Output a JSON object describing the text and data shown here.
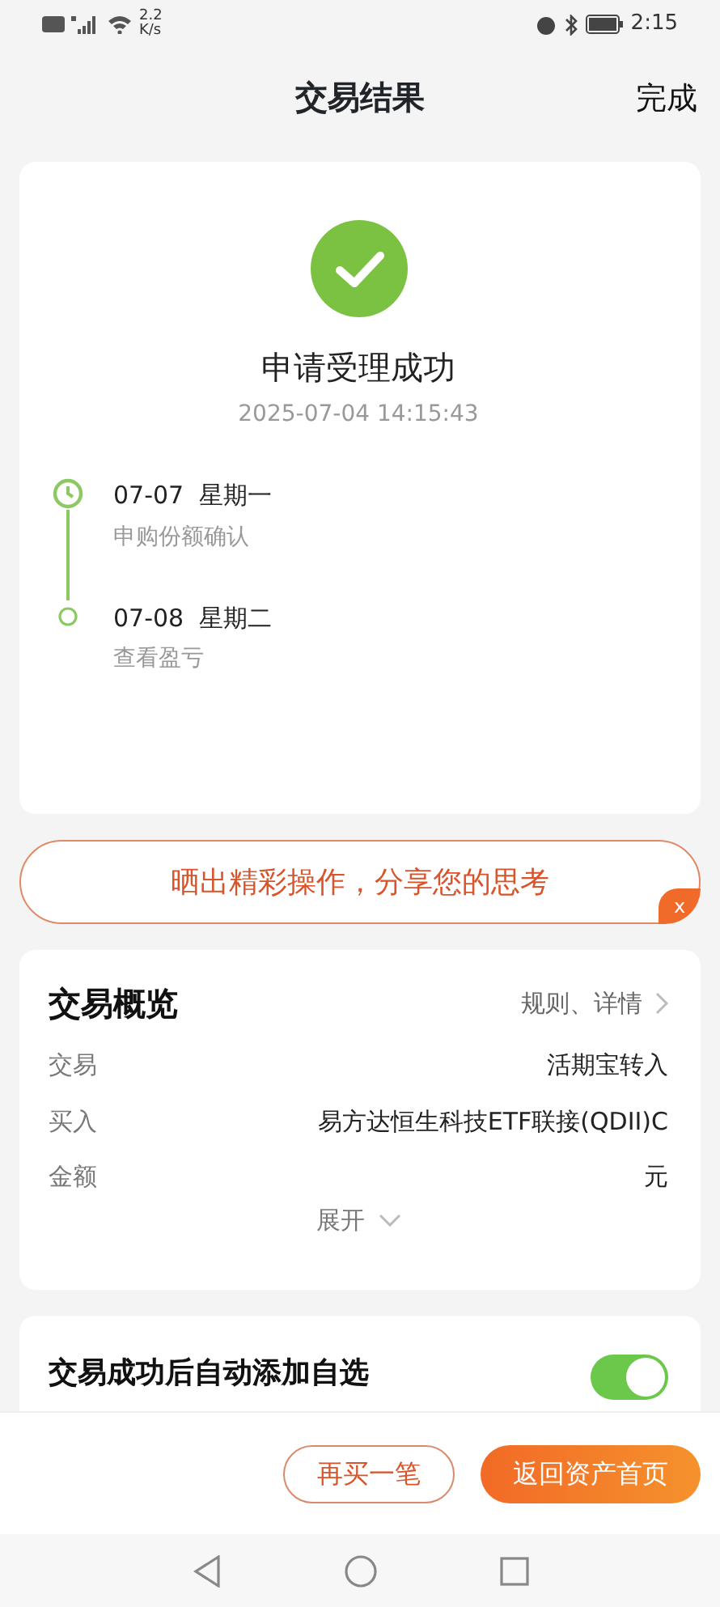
{
  "status_bar": {
    "speed": [
      "2.2",
      "K/s"
    ],
    "time": "2:15"
  },
  "header": {
    "title": "交易结果",
    "action": "完成"
  },
  "result": {
    "title": "申请受理成功",
    "time": "2025-07-04 14:15:43",
    "timeline": [
      {
        "date": "07-07  星期一",
        "note": "申购份额确认",
        "kind": "clock"
      },
      {
        "date": "07-08  星期二",
        "note": "查看盈亏",
        "kind": "dot"
      }
    ]
  },
  "share_banner": {
    "text": "晒出精彩操作，分享您的思考",
    "close": "x"
  },
  "overview": {
    "title": "交易概览",
    "link": "规则、详情",
    "rows": [
      {
        "label": "交易",
        "value": "活期宝转入"
      },
      {
        "label": "买入",
        "value": "易方达恒生科技ETF联接(QDII)C"
      },
      {
        "label": "金额",
        "value": "元"
      }
    ],
    "expand": "展开"
  },
  "auto_watch": {
    "title": "交易成功后自动添加自选",
    "on": true
  },
  "actions": [
    {
      "label": "再买一笔",
      "kind": "outline"
    },
    {
      "label": "返回资产首页",
      "kind": "primary"
    }
  ]
}
